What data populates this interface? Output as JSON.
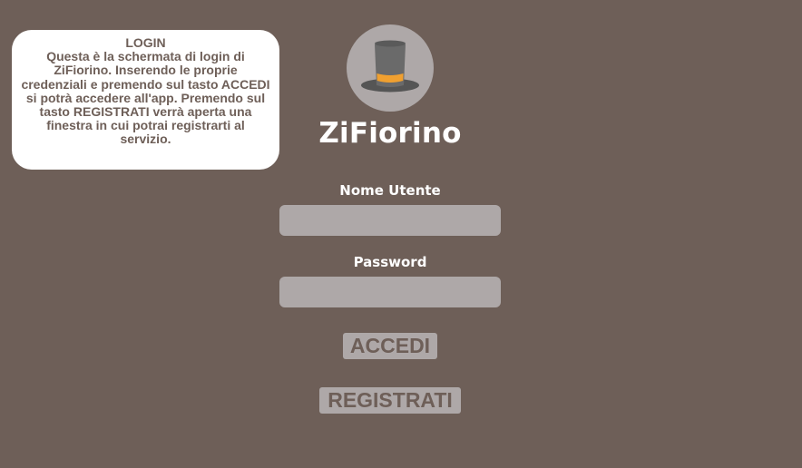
{
  "info": {
    "title": "LOGIN",
    "text": "Questa è la schermata di login di ZiFiorino. Inserendo le proprie credenziali e premendo sul tasto ACCEDI si potrà accedere all'app. Premendo sul tasto REGISTRATI verrà aperta una finestra in cui potrai registrarti al servizio."
  },
  "app": {
    "name": "ZiFiorino",
    "logo_icon": "top-hat-icon"
  },
  "form": {
    "username_label": "Nome Utente",
    "username_value": "",
    "password_label": "Password",
    "password_value": "",
    "login_button": "ACCEDI",
    "register_button": "REGISTRATI"
  },
  "colors": {
    "background": "#6e5f58",
    "field": "#aea8a8",
    "hat_band": "#f0a030"
  }
}
